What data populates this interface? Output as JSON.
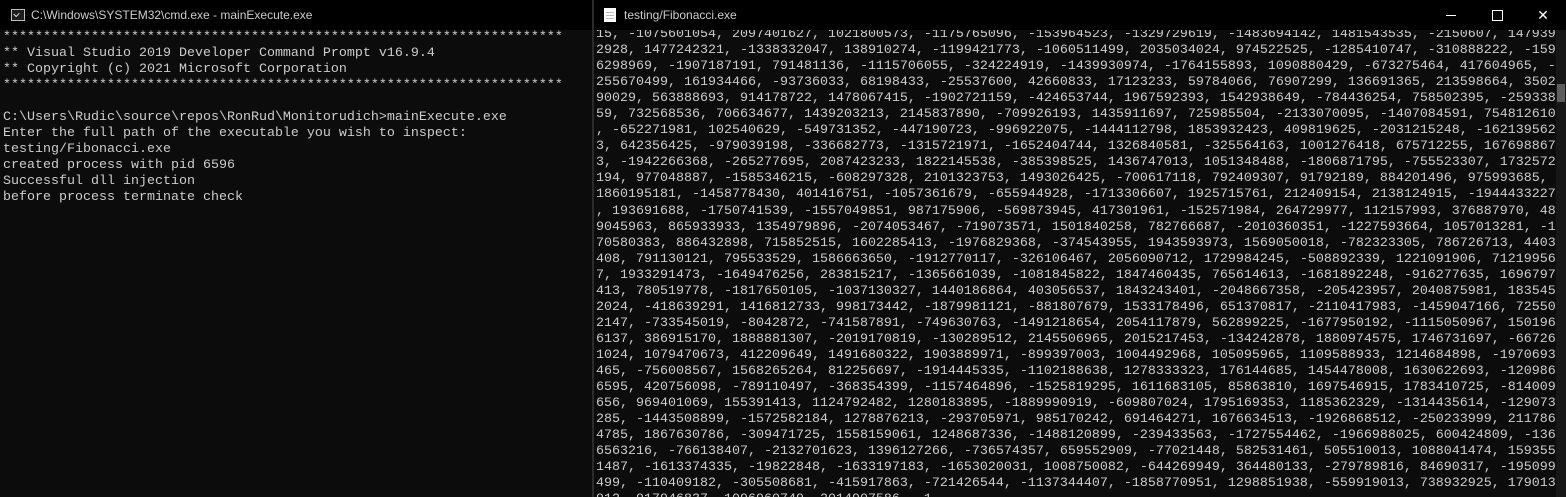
{
  "cmd_window": {
    "title": "C:\\Windows\\SYSTEM32\\cmd.exe - mainExecute.exe",
    "text": "**********************************************************************\n** Visual Studio 2019 Developer Command Prompt v16.9.4\n** Copyright (c) 2021 Microsoft Corporation\n**********************************************************************\n\nC:\\Users\\Rudic\\source\\repos\\RonRud\\Monitorudich>mainExecute.exe\nEnter the full path of the executable you wish to inspect:\ntesting/Fibonacci.exe\ncreated process with pid 6596\nSuccessful dll injection\nbefore process terminate check"
  },
  "fib_window": {
    "title": "testing/Fibonacci.exe",
    "text": "15, -1075601054, 2097401627, 1021800573, -1175765096, -153964523, -1329729619, -1483694142, 1481543535, -2150607, 147939\n2928, 1477242321, -1338332047, 138910274, -1199421773, -1060511499, 2035034024, 974522525, -1285410747, -310888222, -159\n6298969, -1907187191, 791481136, -1115706055, -324224919, -1439930974, -1764155893, 1090880429, -673275464, 417604965, -\n255670499, 161934466, -93736033, 68198433, -25537600, 42660833, 17123233, 59784066, 76907299, 136691365, 213598664, 3502\n90029, 563888693, 914178722, 1478067415, -1902721159, -424653744, 1967592393, 1542938649, -784436254, 758502395, -259338\n59, 732568536, 706634677, 1439203213, 2145837890, -709926193, 1435911697, 725985504, -2133070095, -1407084591, 754812610\n, -652271981, 102540629, -549731352, -447190723, -996922075, -1444112798, 1853932423, 409819625, -2031215248, -162139562\n3, 642356425, -979039198, -336682773, -1315721971, -1652404744, 1326840581, -325564163, 1001276418, 675712255, 167698867\n3, -1942266368, -265277695, 2087423233, 1822145538, -385398525, 1436747013, 1051348488, -1806871795, -755523307, 1732572\n194, 977048887, -1585346215, -608297328, 2101323753, 1493026425, -700617118, 792409307, 91792189, 884201496, 975993685,\n1860195181, -1458778430, 401416751, -1057361679, -655944928, -1713306607, 1925715761, 212409154, 2138124915, -1944433227\n, 193691688, -1750741539, -1557049851, 987175906, -569873945, 417301961, -152571984, 264729977, 112157993, 376887970, 48\n9045963, 865933933, 1354979896, -2074053467, -719073571, 1501840258, 782766687, -2010360351, -1227593664, 1057013281, -1\n70580383, 886432898, 715852515, 1602285413, -1976829368, -374543955, 1943593973, 1569050018, -782323305, 786726713, 4403\n408, 791130121, 795533529, 1586663650, -1912770117, -326106467, 2056090712, 1729984245, -508892339, 1221091906, 71219956\n7, 1933291473, -1649476256, 283815217, -1365661039, -1081845822, 1847460435, 765614613, -1681892248, -916277635, 1696797\n413, 780519778, -1817650105, -1037130327, 1440186864, 403056537, 1843243401, -2048667358, -205423957, 2040875981, 183545\n2024, -418639291, 1416812733, 998173442, -1879981121, -881807679, 1533178496, 651370817, -2110417983, -1459047166, 72550\n2147, -733545019, -8042872, -741587891, -749630763, -1491218654, 2054117879, 562899225, -1677950192, -1115050967, 150196\n6137, 386915170, 1888881307, -2019170819, -130289512, 2145506965, 2015217453, -134242878, 1880974575, 1746731697, -66726\n1024, 1079470673, 412209649, 1491680322, 1903889971, -899397003, 1004492968, 105095965, 1109588933, 1214684898, -1970693\n465, -756008567, 1568265264, 812256697, -1914445335, -1102188638, 1278333323, 176144685, 1454478008, 1630622693, -120986\n6595, 420756098, -789110497, -368354399, -1157464896, -1525819295, 1611683105, 85863810, 1697546915, 1783410725, -814009\n656, 969401069, 155391413, 1124792482, 1280183895, -1889990919, -609807024, 1795169353, 1185362329, -1314435614, -129073\n285, -1443508899, -1572582184, 1278876213, -293705971, 985170242, 691464271, 1676634513, -1926868512, -250233999, 211786\n4785, 1867630786, -309471725, 1558159061, 1248687336, -1488120899, -239433563, -1727554462, -1966988025, 600424809, -136\n6563216, -766138407, -2132701623, 1396127266, -736574357, 659552909, -77021448, 582531461, 505510013, 1088041474, 159355\n1487, -1613374335, -19822848, -1633197183, -1653020031, 1008750082, -644269949, 364480133, -279789816, 84690317, -195099\n499, -110409182, -305508681, -415917863, -721426544, -1137344407, -1858770951, 1298851938, -559919013, 738932925, 179013\n912, 917946837, 1096960749, 2014907586, -1"
  },
  "icons": {
    "cmd": "console-app-icon",
    "fib": "document-icon",
    "minimize": "minimize-icon",
    "maximize": "maximize-icon",
    "close": "close-icon"
  },
  "colors": {
    "background": "#0c0c0c",
    "text": "#cccccc",
    "titlebar": "#000000"
  }
}
